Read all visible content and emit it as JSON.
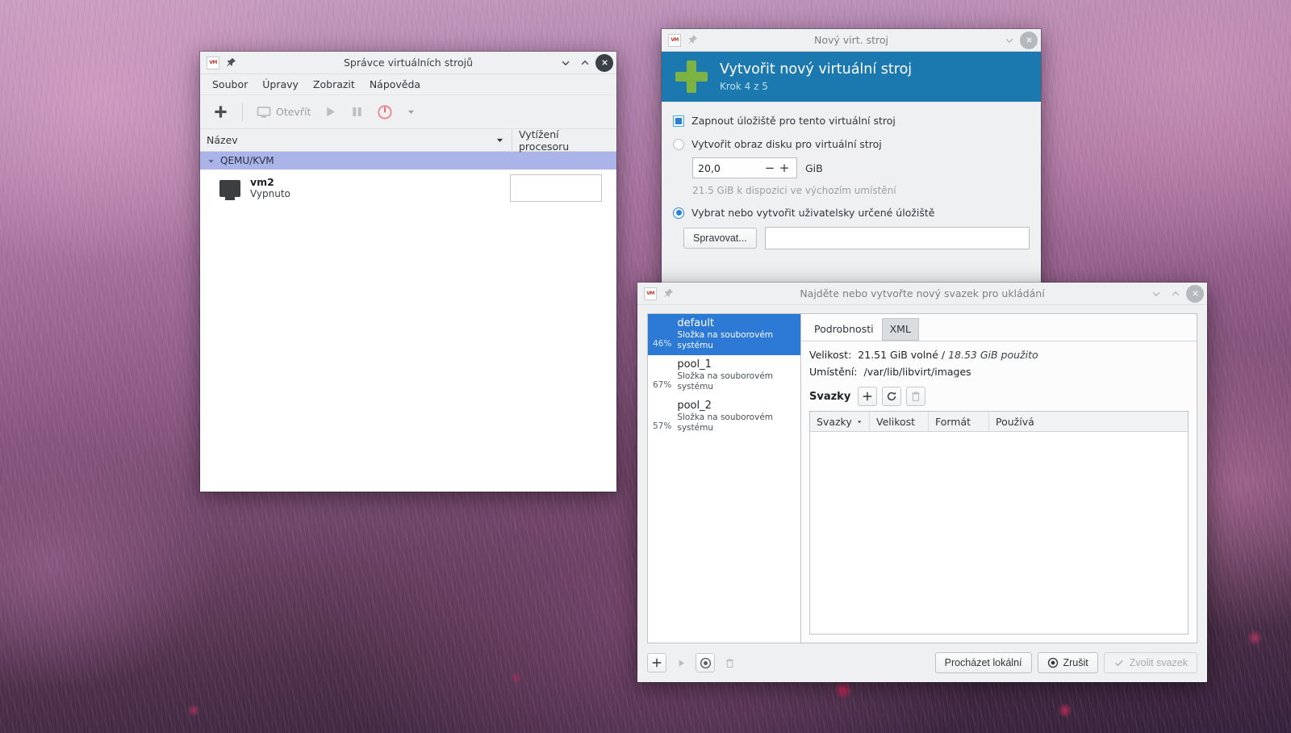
{
  "desktop": {
    "wallpaper_description": "abstract pink-purple grass field"
  },
  "vm_manager": {
    "title": "Správce virtuálních strojů",
    "app_icon": "vmm-icon",
    "pin_icon": "pin-icon",
    "window_buttons": {
      "minimize": "chevron-down-icon",
      "maximize": "chevron-up-icon",
      "close": "close-icon"
    },
    "menu": [
      "Soubor",
      "Úpravy",
      "Zobrazit",
      "Nápověda"
    ],
    "toolbar": [
      {
        "name": "new-vm-button",
        "icon": "plus-icon",
        "label": ""
      },
      {
        "name": "open-button",
        "icon": "monitor-icon",
        "label": "Otevřít"
      },
      {
        "name": "run-button",
        "icon": "play-icon",
        "label": ""
      },
      {
        "name": "pause-button",
        "icon": "pause-icon",
        "label": ""
      },
      {
        "name": "shutdown-button",
        "icon": "power-icon",
        "label": ""
      },
      {
        "name": "shutdown-menu-button",
        "icon": "chevron-down-icon",
        "label": ""
      }
    ],
    "columns": [
      "Název",
      "Vytížení procesoru"
    ],
    "group": {
      "label": "QEMU/KVM",
      "expanded": true
    },
    "rows": [
      {
        "name": "vm2",
        "state": "Vypnuto",
        "cpu_sparkline": ""
      }
    ]
  },
  "wizard": {
    "title": "Nový virt. stroj",
    "app_icon": "vmm-icon",
    "pin_icon": "pin-icon",
    "banner_title": "Vytvořit nový virtuální stroj",
    "banner_step": "Krok 4 z 5",
    "enable_storage": {
      "label": "Zapnout úložiště pro tento virtuální stroj",
      "checked": true
    },
    "create_disk": {
      "label": "Vytvořit obraz disku pro virtuální stroj",
      "selected": false
    },
    "disk_size": {
      "value": "20,0",
      "unit": "GiB",
      "minus": "−",
      "plus": "+"
    },
    "available_hint": "21.5 GiB k dispozici ve výchozím umístění",
    "select_storage": {
      "label": "Vybrat nebo vytvořit uživatelsky určené úložiště",
      "selected": true
    },
    "manage_button": "Spravovat...",
    "storage_path": {
      "value": "",
      "placeholder": ""
    },
    "accent_color": "#1b79b0"
  },
  "storage_dialog": {
    "title": "Najděte nebo vytvořte nový svazek pro ukládání",
    "app_icon": "vmm-icon",
    "pin_icon": "pin-icon",
    "pools": [
      {
        "percent": "46%",
        "name": "default",
        "desc": "Složka na souborovém systému",
        "selected": true
      },
      {
        "percent": "67%",
        "name": "pool_1",
        "desc": "Složka na souborovém systému",
        "selected": false
      },
      {
        "percent": "57%",
        "name": "pool_2",
        "desc": "Složka na souborovém systému",
        "selected": false
      }
    ],
    "pool_toolbar": [
      {
        "name": "add-pool-button",
        "icon": "plus-icon"
      },
      {
        "name": "start-pool-button",
        "icon": "play-icon"
      },
      {
        "name": "stop-pool-button",
        "icon": "stop-icon"
      },
      {
        "name": "delete-pool-button",
        "icon": "trash-icon"
      }
    ],
    "tabs": [
      {
        "label": "Podrobnosti",
        "active": true
      },
      {
        "label": "XML",
        "active": false
      }
    ],
    "details": {
      "size_label": "Velikost:",
      "size_free": "21.51 GiB volné /",
      "size_used": "18.53 GiB použito",
      "location_label": "Umístění:",
      "location_value": "/var/lib/libvirt/images"
    },
    "volumes_section": {
      "title": "Svazky",
      "buttons": [
        {
          "name": "add-volume-button",
          "icon": "plus-icon"
        },
        {
          "name": "refresh-volumes-button",
          "icon": "refresh-icon"
        },
        {
          "name": "delete-volume-button",
          "icon": "trash-icon"
        }
      ],
      "columns": [
        "Svazky",
        "Velikost",
        "Formát",
        "Používá"
      ],
      "rows": []
    },
    "footer": {
      "browse_local": "Procházet lokální",
      "cancel": "Zrušit",
      "choose_volume": "Zvolit svazek",
      "choose_volume_enabled": false
    },
    "selection_color": "#2c7ad6"
  }
}
